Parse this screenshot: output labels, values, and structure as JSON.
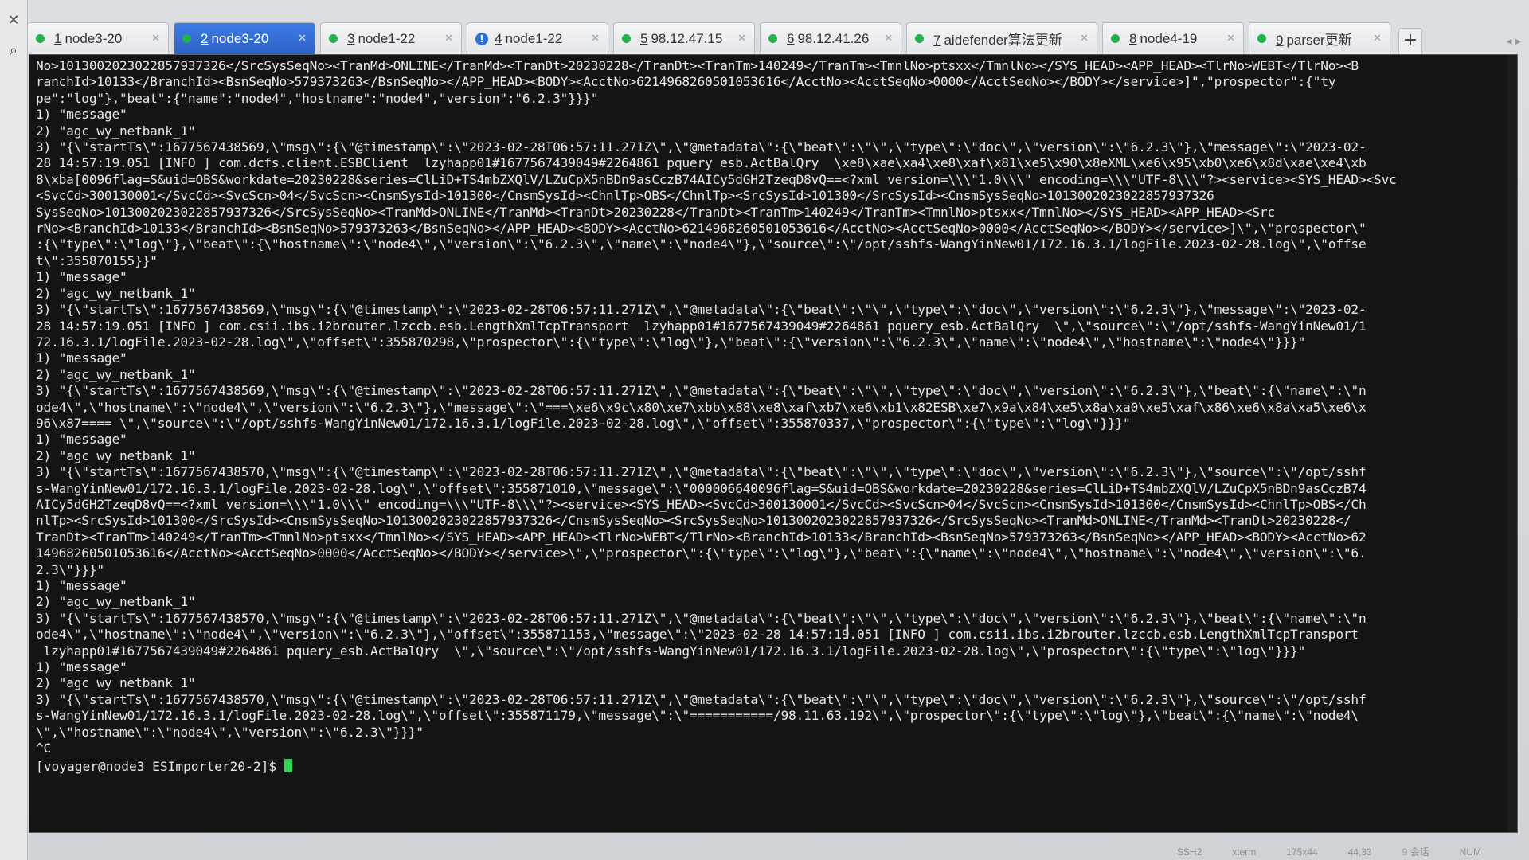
{
  "tabs": [
    {
      "num": "1",
      "label": "node3-20",
      "status": "connected",
      "active": false
    },
    {
      "num": "2",
      "label": "node3-20",
      "status": "connected",
      "active": true
    },
    {
      "num": "3",
      "label": "node1-22",
      "status": "connected",
      "active": false
    },
    {
      "num": "4",
      "label": "node1-22",
      "status": "warning",
      "active": false
    },
    {
      "num": "5",
      "label": "98.12.47.15",
      "status": "connected",
      "active": false
    },
    {
      "num": "6",
      "label": "98.12.41.26",
      "status": "connected",
      "active": false
    },
    {
      "num": "7",
      "label": "aidefender算法更新",
      "status": "connected",
      "active": false
    },
    {
      "num": "8",
      "label": "node4-19",
      "status": "connected",
      "active": false
    },
    {
      "num": "9",
      "label": "parser更新",
      "status": "connected",
      "active": false
    }
  ],
  "new_tab_label": "+",
  "nav_arrows": "◂ ▸",
  "gutter": {
    "close_label": "✕",
    "search_label": "⌕"
  },
  "terminal": {
    "lines": [
      "No>1013002023022857937326</SrcSysSeqNo><TranMd>ONLINE</TranMd><TranDt>20230228</TranDt><TranTm>140249</TranTm><TmnlNo>ptsxx</TmnlNo></SYS_HEAD><APP_HEAD><TlrNo>WEBT</TlrNo><B",
      "ranchId>10133</BranchId><BsnSeqNo>579373263</BsnSeqNo></APP_HEAD><BODY><AcctNo>6214968260501053616</AcctNo><AcctSeqNo>0000</AcctSeqNo></BODY></service>]\",\"prospector\":{\"ty",
      "pe\":\"log\"},\"beat\":{\"name\":\"node4\",\"hostname\":\"node4\",\"version\":\"6.2.3\"}}}\"",
      "1) \"message\"",
      "2) \"agc_wy_netbank_1\"",
      "3) \"{\\\"startTs\\\":1677567438569,\\\"msg\\\":{\\\"@timestamp\\\":\\\"2023-02-28T06:57:11.271Z\\\",\\\"@metadata\\\":{\\\"beat\\\":\\\"\\\",\\\"type\\\":\\\"doc\\\",\\\"version\\\":\\\"6.2.3\\\"},\\\"message\\\":\\\"2023-02-",
      "28 14:57:19.051 [INFO ] com.dcfs.client.ESBClient  lzyhapp01#1677567439049#2264861 pquery_esb.ActBalQry  \\xe8\\xae\\xa4\\xe8\\xaf\\x81\\xe5\\x90\\x8eXML\\xe6\\x95\\xb0\\xe6\\x8d\\xae\\xe4\\xb",
      "8\\xba[0096flag=S&uid=OBS&workdate=20230228&series=ClLiD+TS4mbZXQlV/LZuCpX5nBDn9asCczB74AICy5dGH2TzeqD8vQ==<?xml version=\\\\\\\"1.0\\\\\\\" encoding=\\\\\\\"UTF-8\\\\\\\"?><service><SYS_HEAD><Svc",
      "<SvcCd>300130001</SvcCd><SvcScn>04</SvcScn><CnsmSysId>101300</CnsmSysId><ChnlTp>OBS</ChnlTp><SrcSysId>101300</SrcSysId><CnsmSysSeqNo>1013002023022857937326",
      "SysSeqNo>1013002023022857937326</SrcSysSeqNo><TranMd>ONLINE</TranMd><TranDt>20230228</TranDt><TranTm>140249</TranTm><TmnlNo>ptsxx</TmnlNo></SYS_HEAD><APP_HEAD><Src",
      "rNo><BranchId>10133</BranchId><BsnSeqNo>579373263</BsnSeqNo></APP_HEAD><BODY><AcctNo>6214968260501053616</AcctNo><AcctSeqNo>0000</AcctSeqNo></BODY></service>]\\\",\\\"prospector\\\"",
      ":{\\\"type\\\":\\\"log\\\"},\\\"beat\\\":{\\\"hostname\\\":\\\"node4\\\",\\\"version\\\":\\\"6.2.3\\\",\\\"name\\\":\\\"node4\\\"},\\\"source\\\":\\\"/opt/sshfs-WangYinNew01/172.16.3.1/logFile.2023-02-28.log\\\",\\\"offse",
      "t\\\":355870155}}\"",
      "1) \"message\"",
      "2) \"agc_wy_netbank_1\"",
      "3) \"{\\\"startTs\\\":1677567438569,\\\"msg\\\":{\\\"@timestamp\\\":\\\"2023-02-28T06:57:11.271Z\\\",\\\"@metadata\\\":{\\\"beat\\\":\\\"\\\",\\\"type\\\":\\\"doc\\\",\\\"version\\\":\\\"6.2.3\\\"},\\\"message\\\":\\\"2023-02-",
      "28 14:57:19.051 [INFO ] com.csii.ibs.i2brouter.lzccb.esb.LengthXmlTcpTransport  lzyhapp01#1677567439049#2264861 pquery_esb.ActBalQry  \\\",\\\"source\\\":\\\"/opt/sshfs-WangYinNew01/1",
      "72.16.3.1/logFile.2023-02-28.log\\\",\\\"offset\\\":355870298,\\\"prospector\\\":{\\\"type\\\":\\\"log\\\"},\\\"beat\\\":{\\\"version\\\":\\\"6.2.3\\\",\\\"name\\\":\\\"node4\\\",\\\"hostname\\\":\\\"node4\\\"}}}\"",
      "1) \"message\"",
      "2) \"agc_wy_netbank_1\"",
      "3) \"{\\\"startTs\\\":1677567438569,\\\"msg\\\":{\\\"@timestamp\\\":\\\"2023-02-28T06:57:11.271Z\\\",\\\"@metadata\\\":{\\\"beat\\\":\\\"\\\",\\\"type\\\":\\\"doc\\\",\\\"version\\\":\\\"6.2.3\\\"},\\\"beat\\\":{\\\"name\\\":\\\"n",
      "ode4\\\",\\\"hostname\\\":\\\"node4\\\",\\\"version\\\":\\\"6.2.3\\\"},\\\"message\\\":\\\"===\\xe6\\x9c\\x80\\xe7\\xbb\\x88\\xe8\\xaf\\xb7\\xe6\\xb1\\x82ESB\\xe7\\x9a\\x84\\xe5\\x8a\\xa0\\xe5\\xaf\\x86\\xe6\\x8a\\xa5\\xe6\\x",
      "96\\x87==== \\\",\\\"source\\\":\\\"/opt/sshfs-WangYinNew01/172.16.3.1/logFile.2023-02-28.log\\\",\\\"offset\\\":355870337,\\\"prospector\\\":{\\\"type\\\":\\\"log\\\"}}}\"",
      "1) \"message\"",
      "2) \"agc_wy_netbank_1\"",
      "3) \"{\\\"startTs\\\":1677567438570,\\\"msg\\\":{\\\"@timestamp\\\":\\\"2023-02-28T06:57:11.271Z\\\",\\\"@metadata\\\":{\\\"beat\\\":\\\"\\\",\\\"type\\\":\\\"doc\\\",\\\"version\\\":\\\"6.2.3\\\"},\\\"source\\\":\\\"/opt/sshf",
      "s-WangYinNew01/172.16.3.1/logFile.2023-02-28.log\\\",\\\"offset\\\":355871010,\\\"message\\\":\\\"000006640096flag=S&uid=OBS&workdate=20230228&series=ClLiD+TS4mbZXQlV/LZuCpX5nBDn9asCczB74",
      "AICy5dGH2TzeqD8vQ==<?xml version=\\\\\\\"1.0\\\\\\\" encoding=\\\\\\\"UTF-8\\\\\\\"?><service><SYS_HEAD><SvcCd>300130001</SvcCd><SvcScn>04</SvcScn><CnsmSysId>101300</CnsmSysId><ChnlTp>OBS</Ch",
      "nlTp><SrcSysId>101300</SrcSysId><CnsmSysSeqNo>1013002023022857937326</CnsmSysSeqNo><SrcSysSeqNo>1013002023022857937326</SrcSysSeqNo><TranMd>ONLINE</TranMd><TranDt>20230228</",
      "TranDt><TranTm>140249</TranTm><TmnlNo>ptsxx</TmnlNo></SYS_HEAD><APP_HEAD><TlrNo>WEBT</TlrNo><BranchId>10133</BranchId><BsnSeqNo>579373263</BsnSeqNo></APP_HEAD><BODY><AcctNo>62",
      "14968260501053616</AcctNo><AcctSeqNo>0000</AcctSeqNo></BODY></service>\\\",\\\"prospector\\\":{\\\"type\\\":\\\"log\\\"},\\\"beat\\\":{\\\"name\\\":\\\"node4\\\",\\\"hostname\\\":\\\"node4\\\",\\\"version\\\":\\\"6.",
      "2.3\\\"}}}\"",
      "1) \"message\"",
      "2) \"agc_wy_netbank_1\"",
      "3) \"{\\\"startTs\\\":1677567438570,\\\"msg\\\":{\\\"@timestamp\\\":\\\"2023-02-28T06:57:11.271Z\\\",\\\"@metadata\\\":{\\\"beat\\\":\\\"\\\",\\\"type\\\":\\\"doc\\\",\\\"version\\\":\\\"6.2.3\\\"},\\\"beat\\\":{\\\"name\\\":\\\"n",
      "ode4\\\",\\\"hostname\\\":\\\"node4\\\",\\\"version\\\":\\\"6.2.3\\\"},\\\"offset\\\":355871153,\\\"message\\\":\\\"2023-02-28 14:57:19.051 [INFO ] com.csii.ibs.i2brouter.lzccb.esb.LengthXmlTcpTransport",
      " lzyhapp01#1677567439049#2264861 pquery_esb.ActBalQry  \\\",\\\"source\\\":\\\"/opt/sshfs-WangYinNew01/172.16.3.1/logFile.2023-02-28.log\\\",\\\"prospector\\\":{\\\"type\\\":\\\"log\\\"}}}\"",
      "1) \"message\"",
      "2) \"agc_wy_netbank_1\"",
      "3) \"{\\\"startTs\\\":1677567438570,\\\"msg\\\":{\\\"@timestamp\\\":\\\"2023-02-28T06:57:11.271Z\\\",\\\"@metadata\\\":{\\\"beat\\\":\\\"\\\",\\\"type\\\":\\\"doc\\\",\\\"version\\\":\\\"6.2.3\\\"},\\\"source\\\":\\\"/opt/sshf",
      "s-WangYinNew01/172.16.3.1/logFile.2023-02-28.log\\\",\\\"offset\\\":355871179,\\\"message\\\":\\\"===========/98.11.63.192\\\",\\\"prospector\\\":{\\\"type\\\":\\\"log\\\"},\\\"beat\\\":{\\\"name\\\":\\\"node4\\",
      "\\\",\\\"hostname\\\":\\\"node4\\\",\\\"version\\\":\\\"6.2.3\\\"}}}\"",
      "^C"
    ],
    "prompt": "[voyager@node3 ESImporter20-2]$ "
  },
  "statusbar": [
    "SSH2",
    "xterm",
    "175x44",
    "44,33",
    "9 会话",
    "NUM"
  ]
}
